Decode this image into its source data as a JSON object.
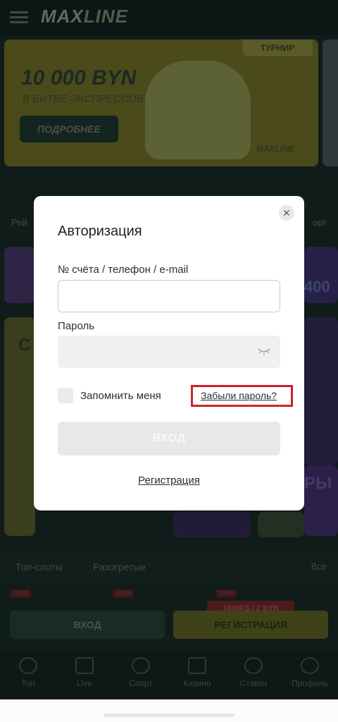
{
  "background": {
    "brand": {
      "logo_main": "MAX",
      "logo_accent": "LINE",
      "logo_tagline": ""
    },
    "banner": {
      "amount": "10 000 BYN",
      "subtitle": "В БИТВЕ ЭКСПРЕССОВ",
      "button": "ПОДРОБНЕЕ",
      "badge": "ТУРНИР",
      "brand": "MAXLINE"
    },
    "categories": {
      "left_label": "Рей",
      "right_label": "орт"
    },
    "tiles": {
      "right_promo": "400",
      "left_letters": "С",
      "right_letters": "РЫ"
    },
    "sections": {
      "tab_top_slots": "Топ-слоты",
      "tab_hot": "Разогретые",
      "tab_all": "Все"
    },
    "chips": [
      "10000",
      "10000",
      "10000"
    ],
    "promo_amount": "1000FS / 2 BYN",
    "buttons": {
      "login": "ВХОД",
      "register": "РЕГИСТРАЦИЯ"
    },
    "bottom_nav": [
      {
        "label": "Топ",
        "icon": "flame-icon"
      },
      {
        "label": "Live",
        "icon": "live-icon"
      },
      {
        "label": "Спорт",
        "icon": "ball-icon"
      },
      {
        "label": "Казино",
        "icon": "casino-icon"
      },
      {
        "label": "Ставки",
        "icon": "clock-icon"
      },
      {
        "label": "Профиль",
        "icon": "user-icon"
      }
    ]
  },
  "modal": {
    "title": "Авторизация",
    "login_label": "№ счёта / телефон / e-mail",
    "login_value": "",
    "password_label": "Пароль",
    "password_value": "",
    "remember_label": "Запомнить меня",
    "remember_checked": false,
    "forgot_link": "Забыли пароль?",
    "submit_label": "ВХОД",
    "register_link": "Регистрация",
    "close_icon": "close-icon",
    "highlight_color": "#d0202c"
  }
}
